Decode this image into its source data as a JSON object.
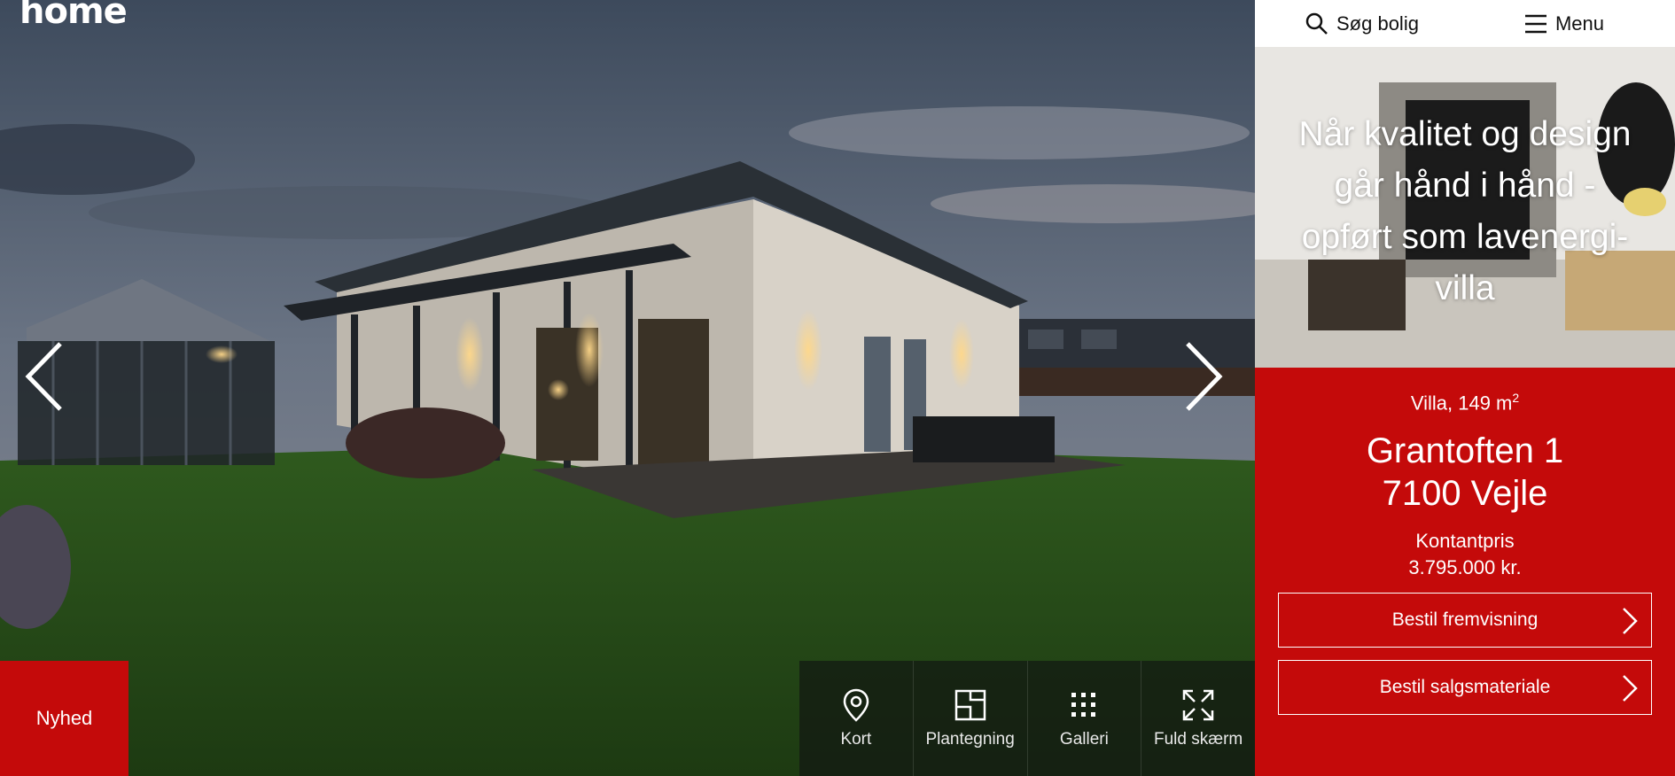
{
  "brand": {
    "logo_text": "home"
  },
  "hero": {
    "badge": "Nyhed",
    "media_buttons": [
      {
        "label": "Kort",
        "icon": "map-pin-icon"
      },
      {
        "label": "Plantegning",
        "icon": "floorplan-icon"
      },
      {
        "label": "Galleri",
        "icon": "grid-dots-icon"
      },
      {
        "label": "Fuld skærm",
        "icon": "fullscreen-icon"
      }
    ]
  },
  "topbar": {
    "search_label": "Søg bolig",
    "menu_label": "Menu"
  },
  "promo": {
    "text": "Når kvalitet og design går hånd i hånd - opført som lavenergi-villa"
  },
  "listing": {
    "type": "Villa, 149 m",
    "unit_sup": "2",
    "street": "Grantoften 1",
    "city": "7100 Vejle",
    "price_label": "Kontantpris",
    "price": "3.795.000 kr.",
    "cta_viewing": "Bestil fremvisning",
    "cta_material": "Bestil salgsmateriale"
  },
  "colors": {
    "brand_red": "#c40a0a",
    "topbar_bg": "#ffffff",
    "media_bar_bg": "#12181299"
  }
}
